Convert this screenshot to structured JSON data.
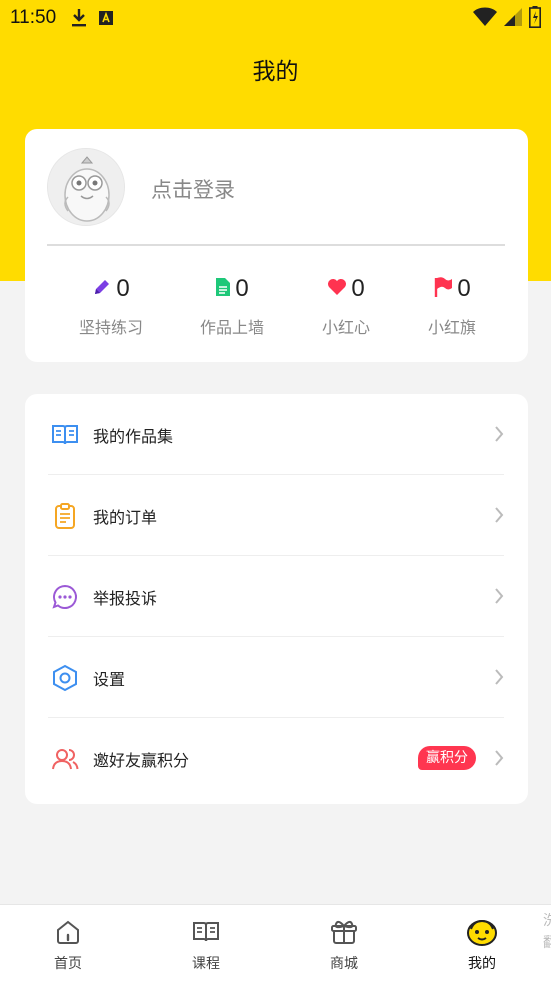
{
  "status_bar": {
    "time": "11:50"
  },
  "header": {
    "title": "我的"
  },
  "profile": {
    "login_text": "点击登录",
    "stats": [
      {
        "value": "0",
        "label": "坚持练习",
        "icon": "pencil-icon",
        "color": "#7b3fe4"
      },
      {
        "value": "0",
        "label": "作品上墙",
        "icon": "document-icon",
        "color": "#1ec879"
      },
      {
        "value": "0",
        "label": "小红心",
        "icon": "heart-icon",
        "color": "#ff3350"
      },
      {
        "value": "0",
        "label": "小红旗",
        "icon": "flag-icon",
        "color": "#ff3350"
      }
    ]
  },
  "menu": {
    "items": [
      {
        "label": "我的作品集",
        "icon": "book-icon",
        "color": "#3d8ff0"
      },
      {
        "label": "我的订单",
        "icon": "clipboard-icon",
        "color": "#f5a623"
      },
      {
        "label": "举报投诉",
        "icon": "chat-bubble-icon",
        "color": "#9b59d6"
      },
      {
        "label": "设置",
        "icon": "hexagon-settings-icon",
        "color": "#3d8ff0"
      },
      {
        "label": "邀好友赢积分",
        "icon": "users-icon",
        "color": "#f06262",
        "badge": "赢积分"
      }
    ]
  },
  "bottom_nav": {
    "items": [
      {
        "label": "首页",
        "icon": "home-icon"
      },
      {
        "label": "课程",
        "icon": "book-icon"
      },
      {
        "label": "商城",
        "icon": "gift-icon"
      },
      {
        "label": "我的",
        "icon": "mascot-face-icon",
        "active": true
      }
    ],
    "edge_text": "洗 翻"
  },
  "colors": {
    "brand_yellow": "#ffdc00",
    "badge_red": "#ff3650"
  }
}
